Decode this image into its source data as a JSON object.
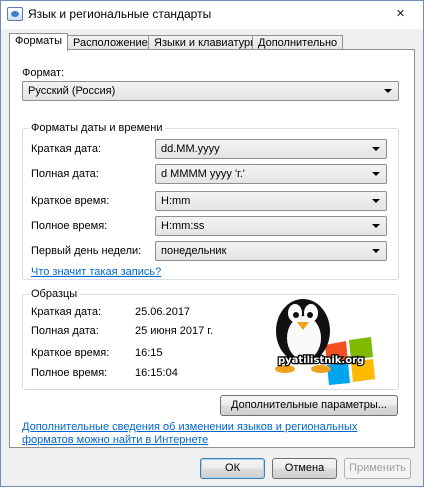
{
  "window": {
    "title": "Язык и региональные стандарты",
    "close_label": "✕"
  },
  "tabs": [
    {
      "label": "Форматы",
      "active": true
    },
    {
      "label": "Расположение",
      "active": false
    },
    {
      "label": "Языки и клавиатуры",
      "active": false
    },
    {
      "label": "Дополнительно",
      "active": false
    }
  ],
  "format": {
    "label": "Формат:",
    "value": "Русский (Россия)"
  },
  "datetime_group": {
    "title": "Форматы даты и времени",
    "rows": [
      {
        "label": "Краткая дата:",
        "value": "dd.MM.yyyy"
      },
      {
        "label": "Полная дата:",
        "value": "d MMMM yyyy 'г.'"
      },
      {
        "label": "Краткое время:",
        "value": "H:mm"
      },
      {
        "label": "Полное время:",
        "value": "H:mm:ss"
      },
      {
        "label": "Первый день недели:",
        "value": "понедельник"
      }
    ],
    "help_link": "Что значит такая запись?"
  },
  "samples_group": {
    "title": "Образцы",
    "rows": [
      {
        "label": "Краткая дата:",
        "value": "25.06.2017"
      },
      {
        "label": "Полная дата:",
        "value": "25 июня 2017 г."
      },
      {
        "label": "Краткое время:",
        "value": "16:15"
      },
      {
        "label": "Полное время:",
        "value": "16:15:04"
      }
    ]
  },
  "watermark_text": "pyatilistnik.org",
  "additional_settings_button": "Дополнительные параметры...",
  "info_link": {
    "line1": "Дополнительные сведения об изменении языков и региональных",
    "line2": "форматов можно найти в Интернете"
  },
  "footer": {
    "ok": "ОК",
    "cancel": "Отмена",
    "apply": "Применить"
  },
  "colors": {
    "link": "#0066cc",
    "border": "#8e8f8f",
    "window_bg": "#f0f0f0"
  }
}
